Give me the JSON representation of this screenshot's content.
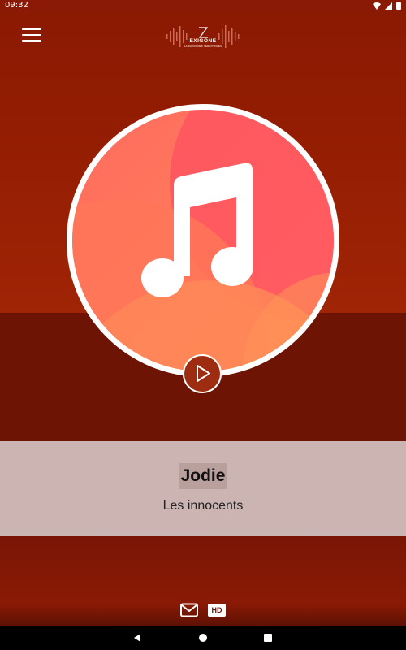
{
  "status_bar": {
    "time": "09:32"
  },
  "header": {
    "logo_text": "EXIGONE",
    "logo_subtext": "LA RADIO DES TERRITOIRES",
    "menu_icon": "hamburger-menu-icon"
  },
  "now_playing": {
    "title": "Jodie",
    "artist": "Les innocents",
    "cover_icon": "music-note-icon",
    "play_icon": "play-icon"
  },
  "footer": {
    "mail_icon": "mail-icon",
    "hd_label": "HD"
  },
  "colors": {
    "top_background": "#931d02",
    "mid_background": "#6e1404",
    "info_panel": "#cbb4b1",
    "title_highlight": "#b9a09c",
    "cover_gradient_a": "#ff5a5f",
    "cover_gradient_b": "#ff8a5c"
  }
}
